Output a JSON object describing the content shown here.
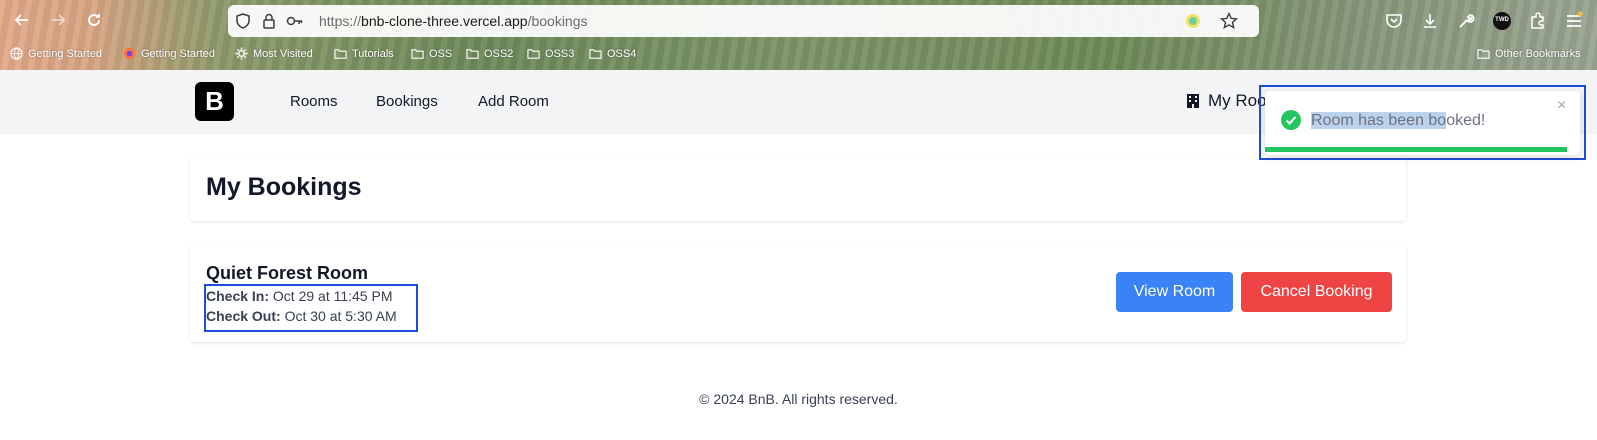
{
  "browser": {
    "url_scheme": "https://",
    "url_host": "bnb-clone-three.vercel.app",
    "url_path": "/bookings",
    "bookmarks": [
      {
        "label": "Getting Started",
        "icon": "globe-icon"
      },
      {
        "label": "Getting Started",
        "icon": "firefox-icon"
      },
      {
        "label": "Most Visited",
        "icon": "gear-icon"
      },
      {
        "label": "Tutorials",
        "icon": "folder-icon"
      },
      {
        "label": "OSS",
        "icon": "folder-icon"
      },
      {
        "label": "OSS2",
        "icon": "folder-icon"
      },
      {
        "label": "OSS3",
        "icon": "folder-icon"
      },
      {
        "label": "OSS4",
        "icon": "folder-icon"
      }
    ],
    "other_bookmarks": "Other Bookmarks",
    "profile_badge": "TWD"
  },
  "header": {
    "logo": "B",
    "nav": [
      "Rooms",
      "Bookings",
      "Add Room"
    ],
    "my_rooms": "My Roo"
  },
  "main": {
    "title": "My Bookings",
    "booking": {
      "room_name": "Quiet Forest Room",
      "check_in_label": "Check In:",
      "check_in_value": "Oct 29 at 11:45 PM",
      "check_out_label": "Check Out:",
      "check_out_value": "Oct 30 at 5:30 AM",
      "view_button": "View Room",
      "cancel_button": "Cancel Booking"
    }
  },
  "footer": {
    "text": "© 2024 BnB. All rights reserved."
  },
  "toast": {
    "message_selected": "Room has been bo",
    "message_rest": "oked!",
    "close": "×",
    "progress": 0.96
  },
  "colors": {
    "primary": "#3b82f6",
    "danger": "#ef4444",
    "success": "#22c55e",
    "annotation": "#1d4ed8"
  }
}
